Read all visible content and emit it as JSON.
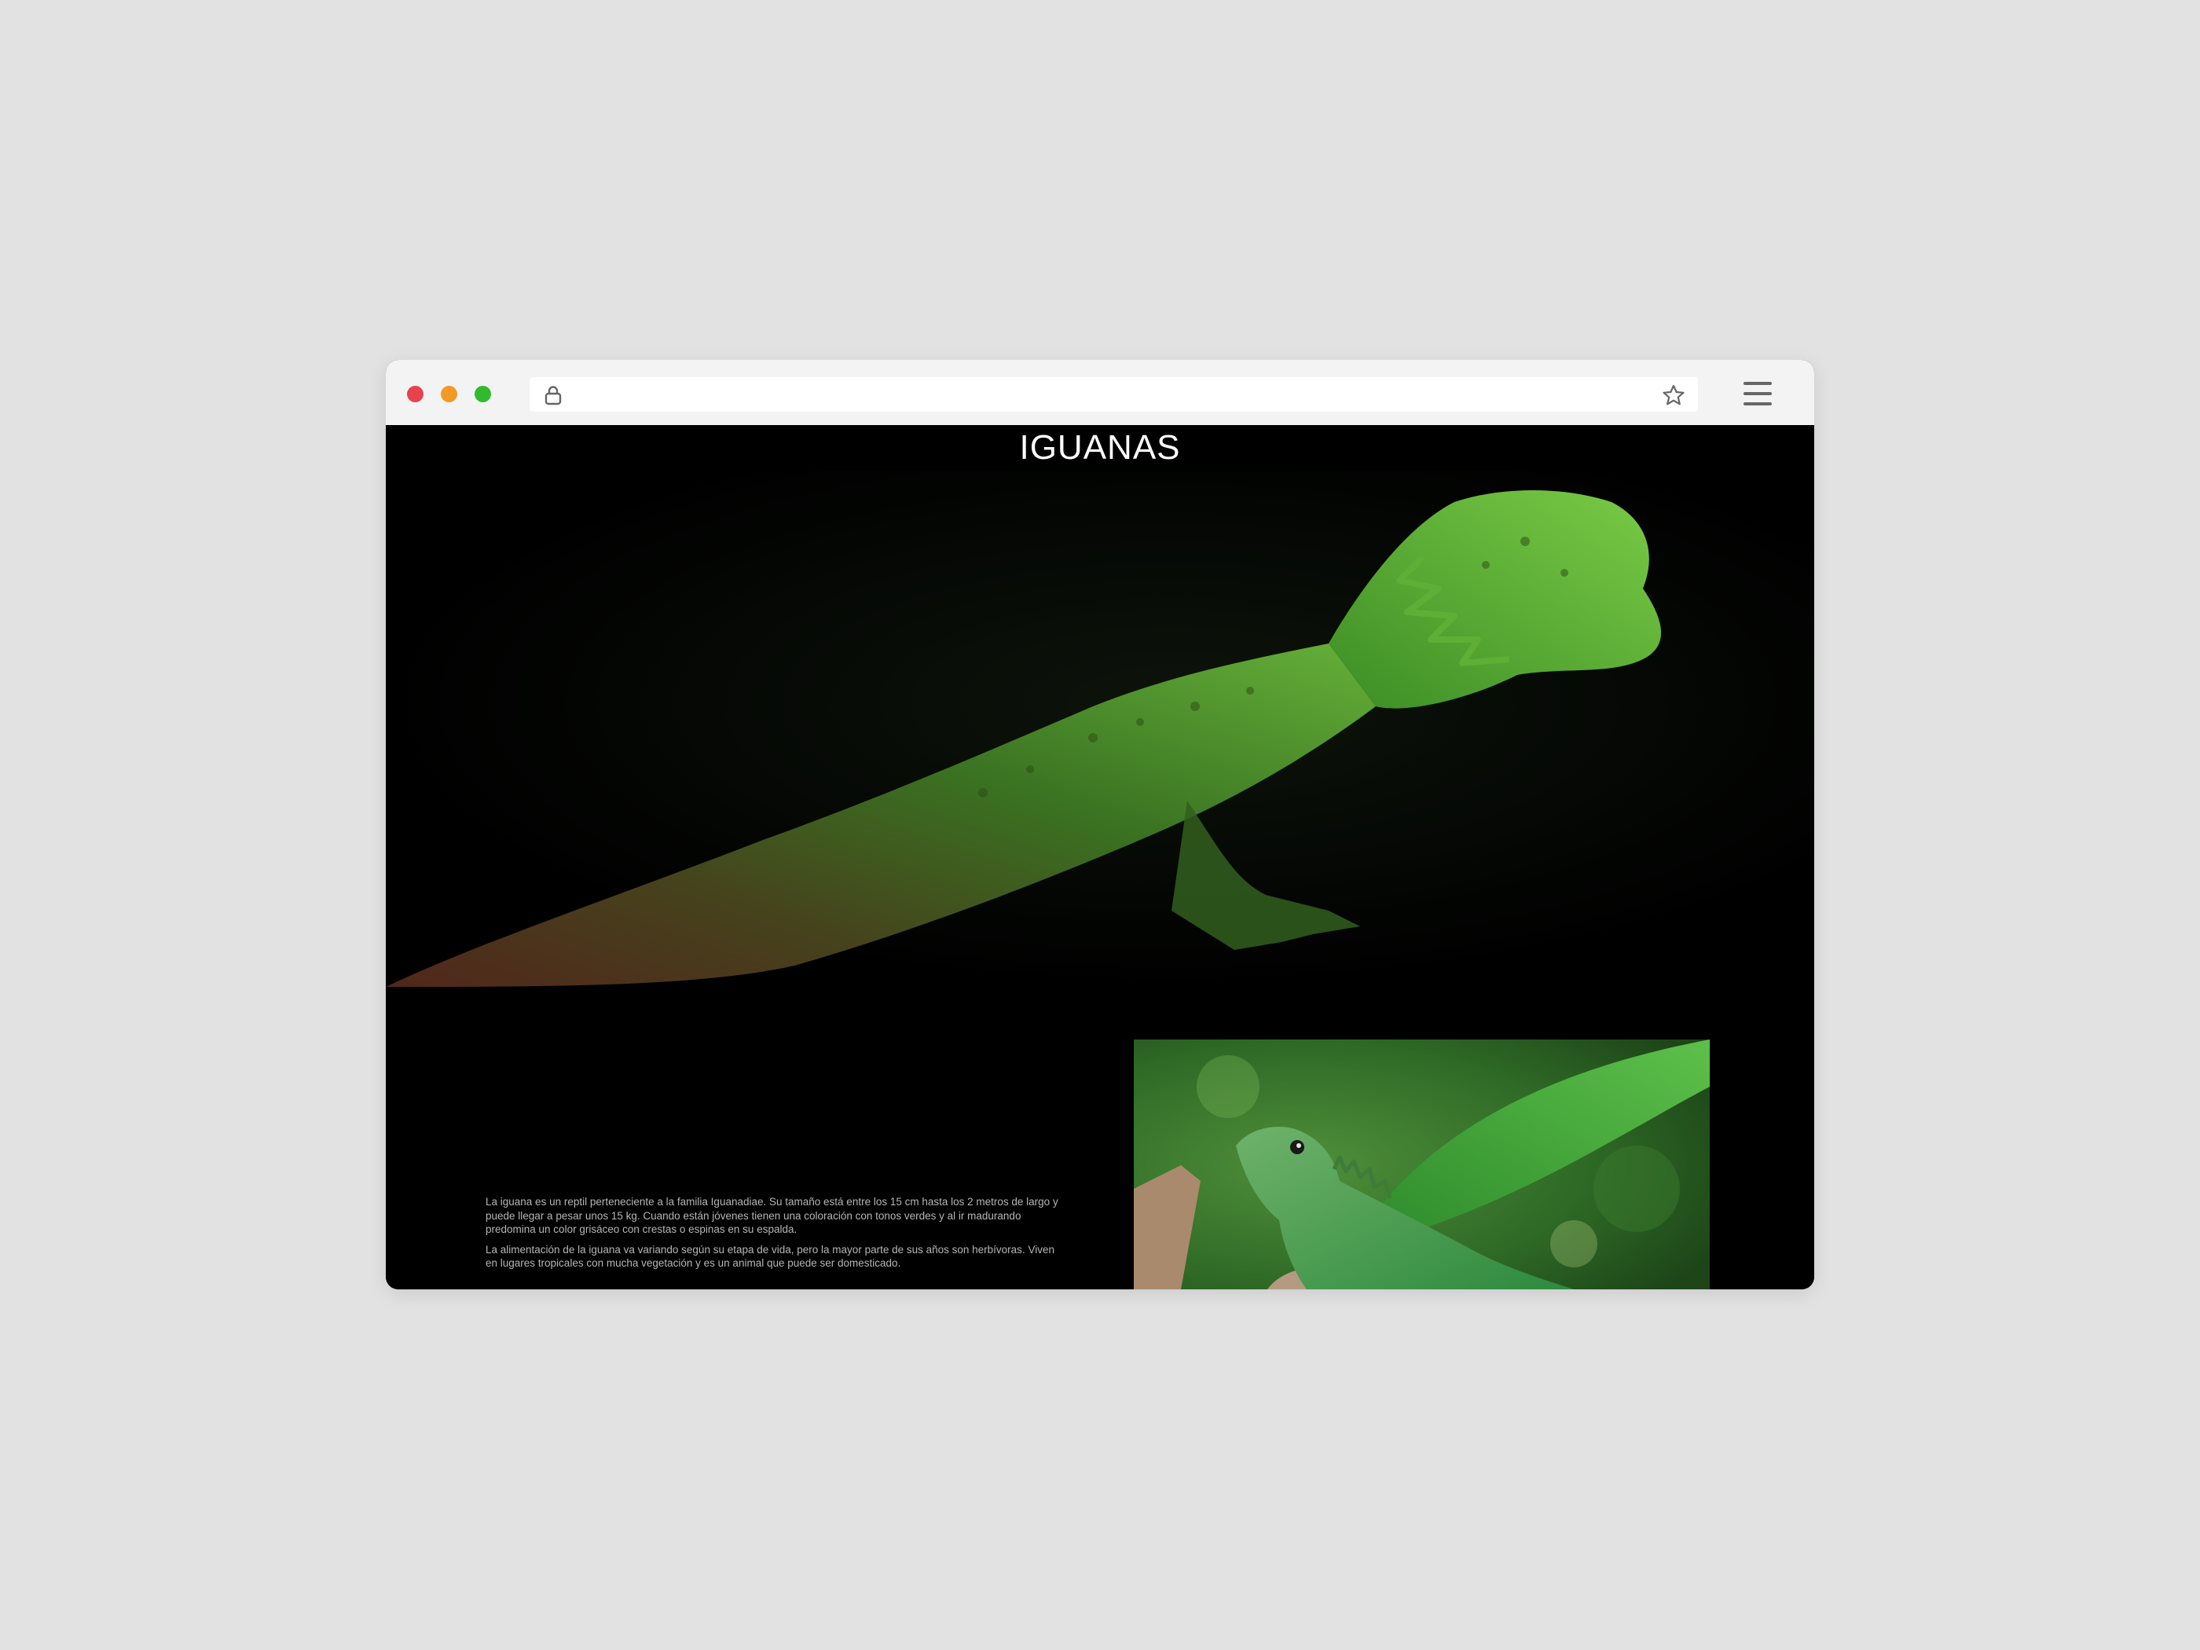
{
  "browser": {
    "url": "",
    "icons": {
      "window_close": "close-dot",
      "window_minimize": "minimize-dot",
      "window_maximize": "maximize-dot",
      "lock": "lock-icon",
      "bookmark": "star-icon",
      "menu": "hamburger-menu-icon"
    }
  },
  "page": {
    "title": "IGUANAS",
    "hero_image": "dark photo of a green iguana on black background",
    "paragraphs": [
      "La iguana es un reptil perteneciente a la familia Iguanadiae. Su tamaño está entre los 15 cm hasta los 2 metros de largo y puede llegar a pesar unos 15 kg. Cuando están jóvenes tienen una coloración con tonos verdes y al ir madurando predomina un color grisáceo con crestas o espinas en su espalda.",
      "La alimentación de la iguana va variando según su etapa de vida, pero la mayor parte de sus años son herbívoras. Viven en lugares tropicales con mucha vegetación y es un animal que puede ser domesticado."
    ],
    "secondary_image": "green iguana on branch with leafy background"
  },
  "colors": {
    "page_background": "#000000",
    "title_text": "#ffffff",
    "body_text": "#b5b5b5",
    "chrome_background": "#f3f3f3",
    "close": "#e8424e",
    "minimize": "#f29a24",
    "maximize": "#31ba2e"
  }
}
